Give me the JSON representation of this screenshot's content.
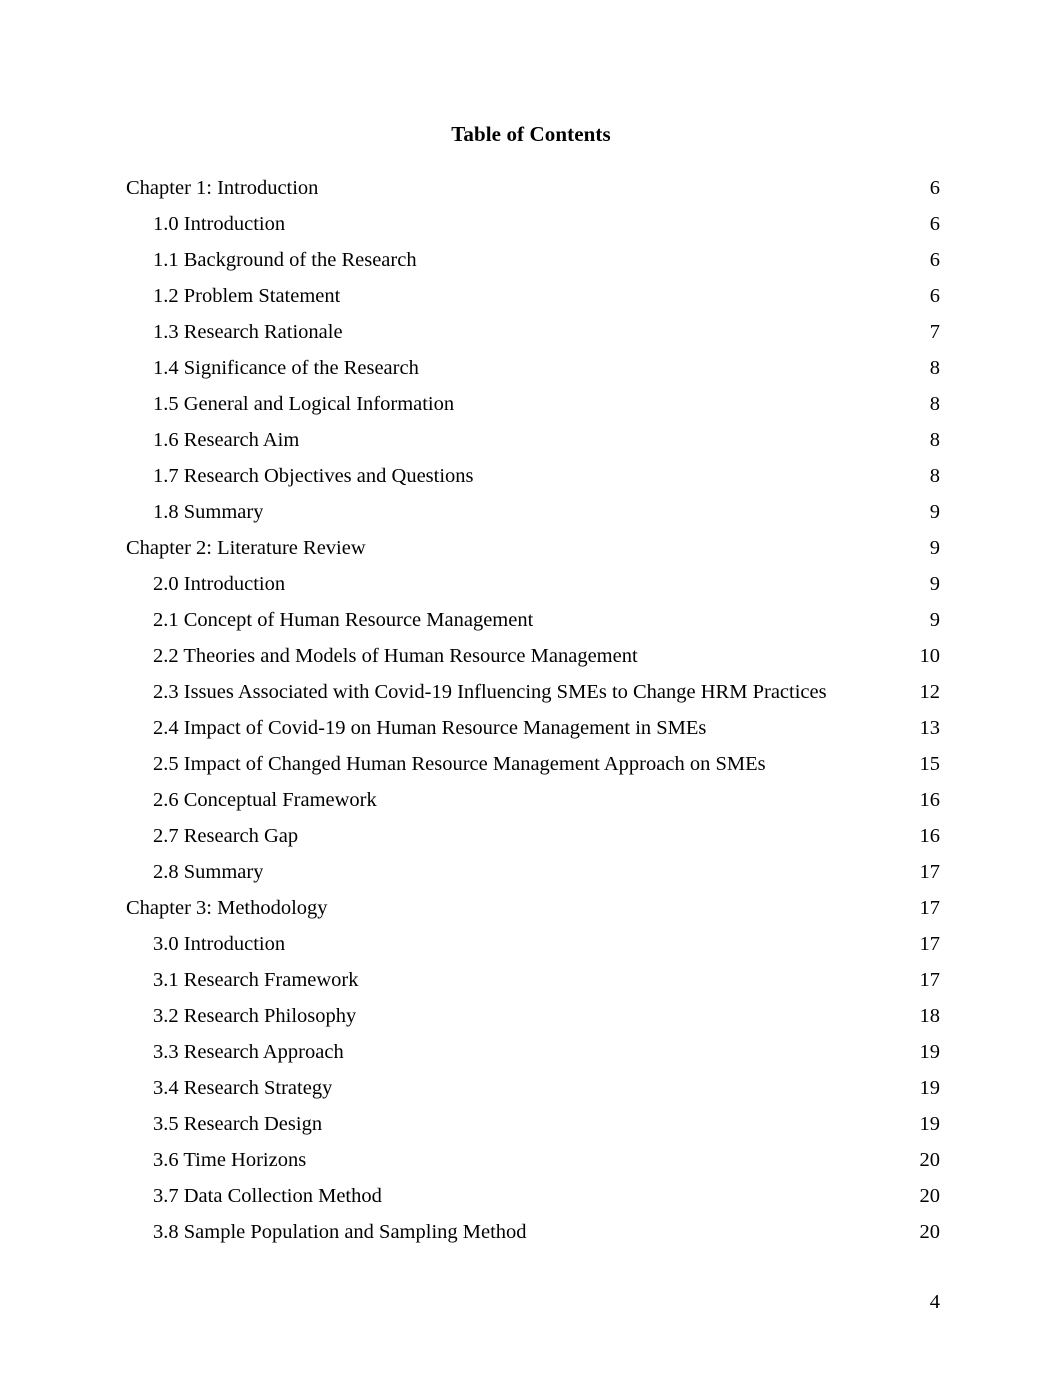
{
  "document": {
    "title": "Table of Contents",
    "footer_page_number": "4"
  },
  "toc": {
    "entries": [
      {
        "label": "Chapter 1: Introduction",
        "page": "6",
        "level": 1
      },
      {
        "label": "1.0 Introduction",
        "page": "6",
        "level": 2
      },
      {
        "label": "1.1 Background of the Research",
        "page": "6",
        "level": 2
      },
      {
        "label": "1.2 Problem Statement",
        "page": "6",
        "level": 2
      },
      {
        "label": "1.3 Research Rationale",
        "page": "7",
        "level": 2
      },
      {
        "label": "1.4 Significance of the Research",
        "page": "8",
        "level": 2
      },
      {
        "label": "1.5 General and Logical Information",
        "page": "8",
        "level": 2
      },
      {
        "label": "1.6 Research Aim",
        "page": "8",
        "level": 2
      },
      {
        "label": "1.7 Research Objectives and Questions",
        "page": "8",
        "level": 2
      },
      {
        "label": "1.8 Summary",
        "page": "9",
        "level": 2
      },
      {
        "label": "Chapter 2: Literature Review",
        "page": "9",
        "level": 1
      },
      {
        "label": "2.0 Introduction",
        "page": "9",
        "level": 2
      },
      {
        "label": "2.1 Concept of Human Resource Management",
        "page": "9",
        "level": 2
      },
      {
        "label": "2.2 Theories and Models of Human Resource Management",
        "page": "10",
        "level": 2
      },
      {
        "label": "2.3 Issues Associated with Covid-19 Influencing SMEs to Change HRM Practices",
        "page": "12",
        "level": 2
      },
      {
        "label": "2.4 Impact of Covid-19 on Human Resource Management in SMEs",
        "page": "13",
        "level": 2
      },
      {
        "label": "2.5 Impact of Changed Human Resource Management Approach on SMEs",
        "page": "15",
        "level": 2
      },
      {
        "label": "2.6 Conceptual Framework",
        "page": "16",
        "level": 2
      },
      {
        "label": "2.7 Research Gap",
        "page": "16",
        "level": 2
      },
      {
        "label": "2.8 Summary",
        "page": "17",
        "level": 2
      },
      {
        "label": "Chapter 3: Methodology",
        "page": "17",
        "level": 1
      },
      {
        "label": "3.0 Introduction",
        "page": "17",
        "level": 2
      },
      {
        "label": "3.1 Research Framework",
        "page": "17",
        "level": 2
      },
      {
        "label": "3.2 Research Philosophy",
        "page": "18",
        "level": 2
      },
      {
        "label": "3.3 Research Approach",
        "page": "19",
        "level": 2
      },
      {
        "label": "3.4 Research Strategy",
        "page": "19",
        "level": 2
      },
      {
        "label": "3.5 Research Design",
        "page": "19",
        "level": 2
      },
      {
        "label": "3.6 Time Horizons",
        "page": "20",
        "level": 2
      },
      {
        "label": "3.7 Data Collection Method",
        "page": "20",
        "level": 2
      },
      {
        "label": "3.8 Sample Population and Sampling Method",
        "page": "20",
        "level": 2
      }
    ]
  }
}
